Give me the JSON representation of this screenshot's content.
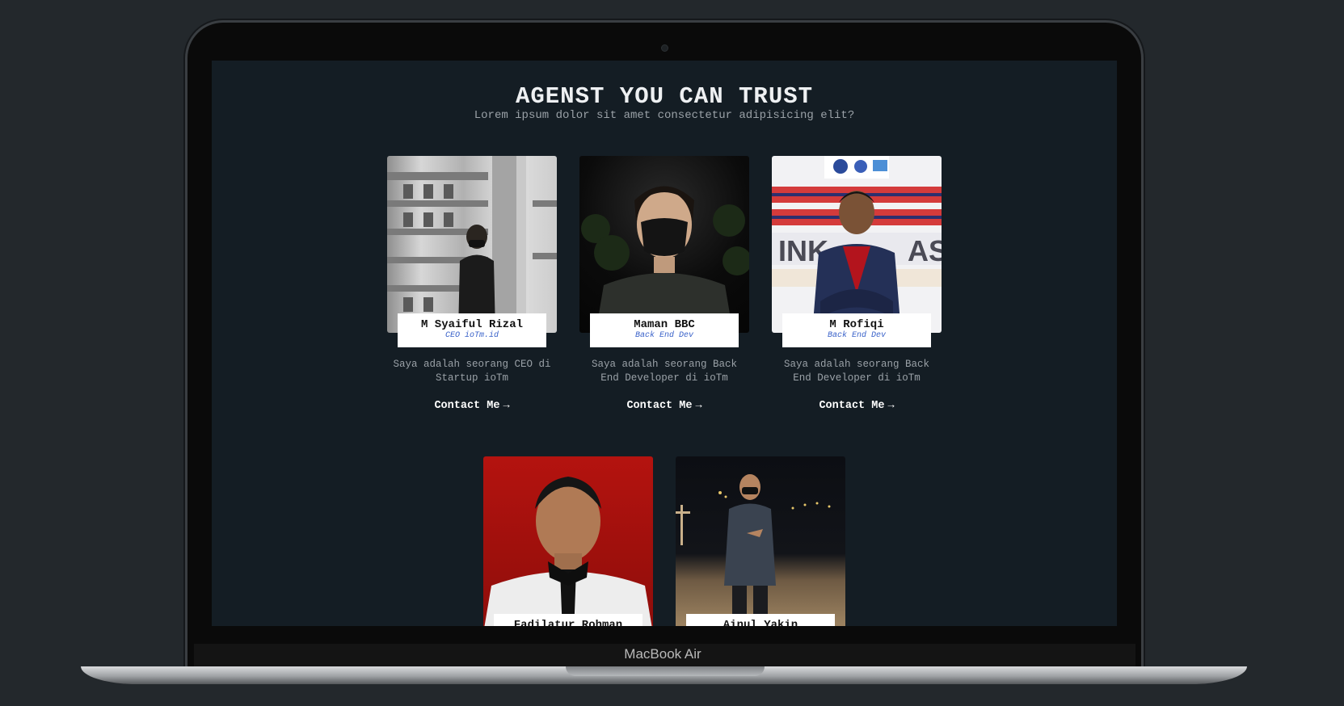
{
  "device": {
    "brand": "MacBook Air"
  },
  "section": {
    "title": "AGENST YOU CAN TRUST",
    "subtitle": "Lorem ipsum dolor sit amet consectetur adipisicing elit?"
  },
  "agents": [
    {
      "name": "M Syaiful Rizal",
      "role": "CEO ioTm.id",
      "description": "Saya adalah seorang CEO di Startup ioTm",
      "contact_label": "Contact Me",
      "arrow": "→"
    },
    {
      "name": "Maman BBC",
      "role": "Back End Dev",
      "description": "Saya adalah seorang Back End Developer di ioTm",
      "contact_label": "Contact Me",
      "arrow": "→"
    },
    {
      "name": "M Rofiqi",
      "role": "Back End Dev",
      "description": "Saya adalah seorang Back End Developer di ioTm",
      "contact_label": "Contact Me",
      "arrow": "→"
    },
    {
      "name": "Fadilatur Rohman"
    },
    {
      "name": "Ainul Yakin"
    }
  ]
}
